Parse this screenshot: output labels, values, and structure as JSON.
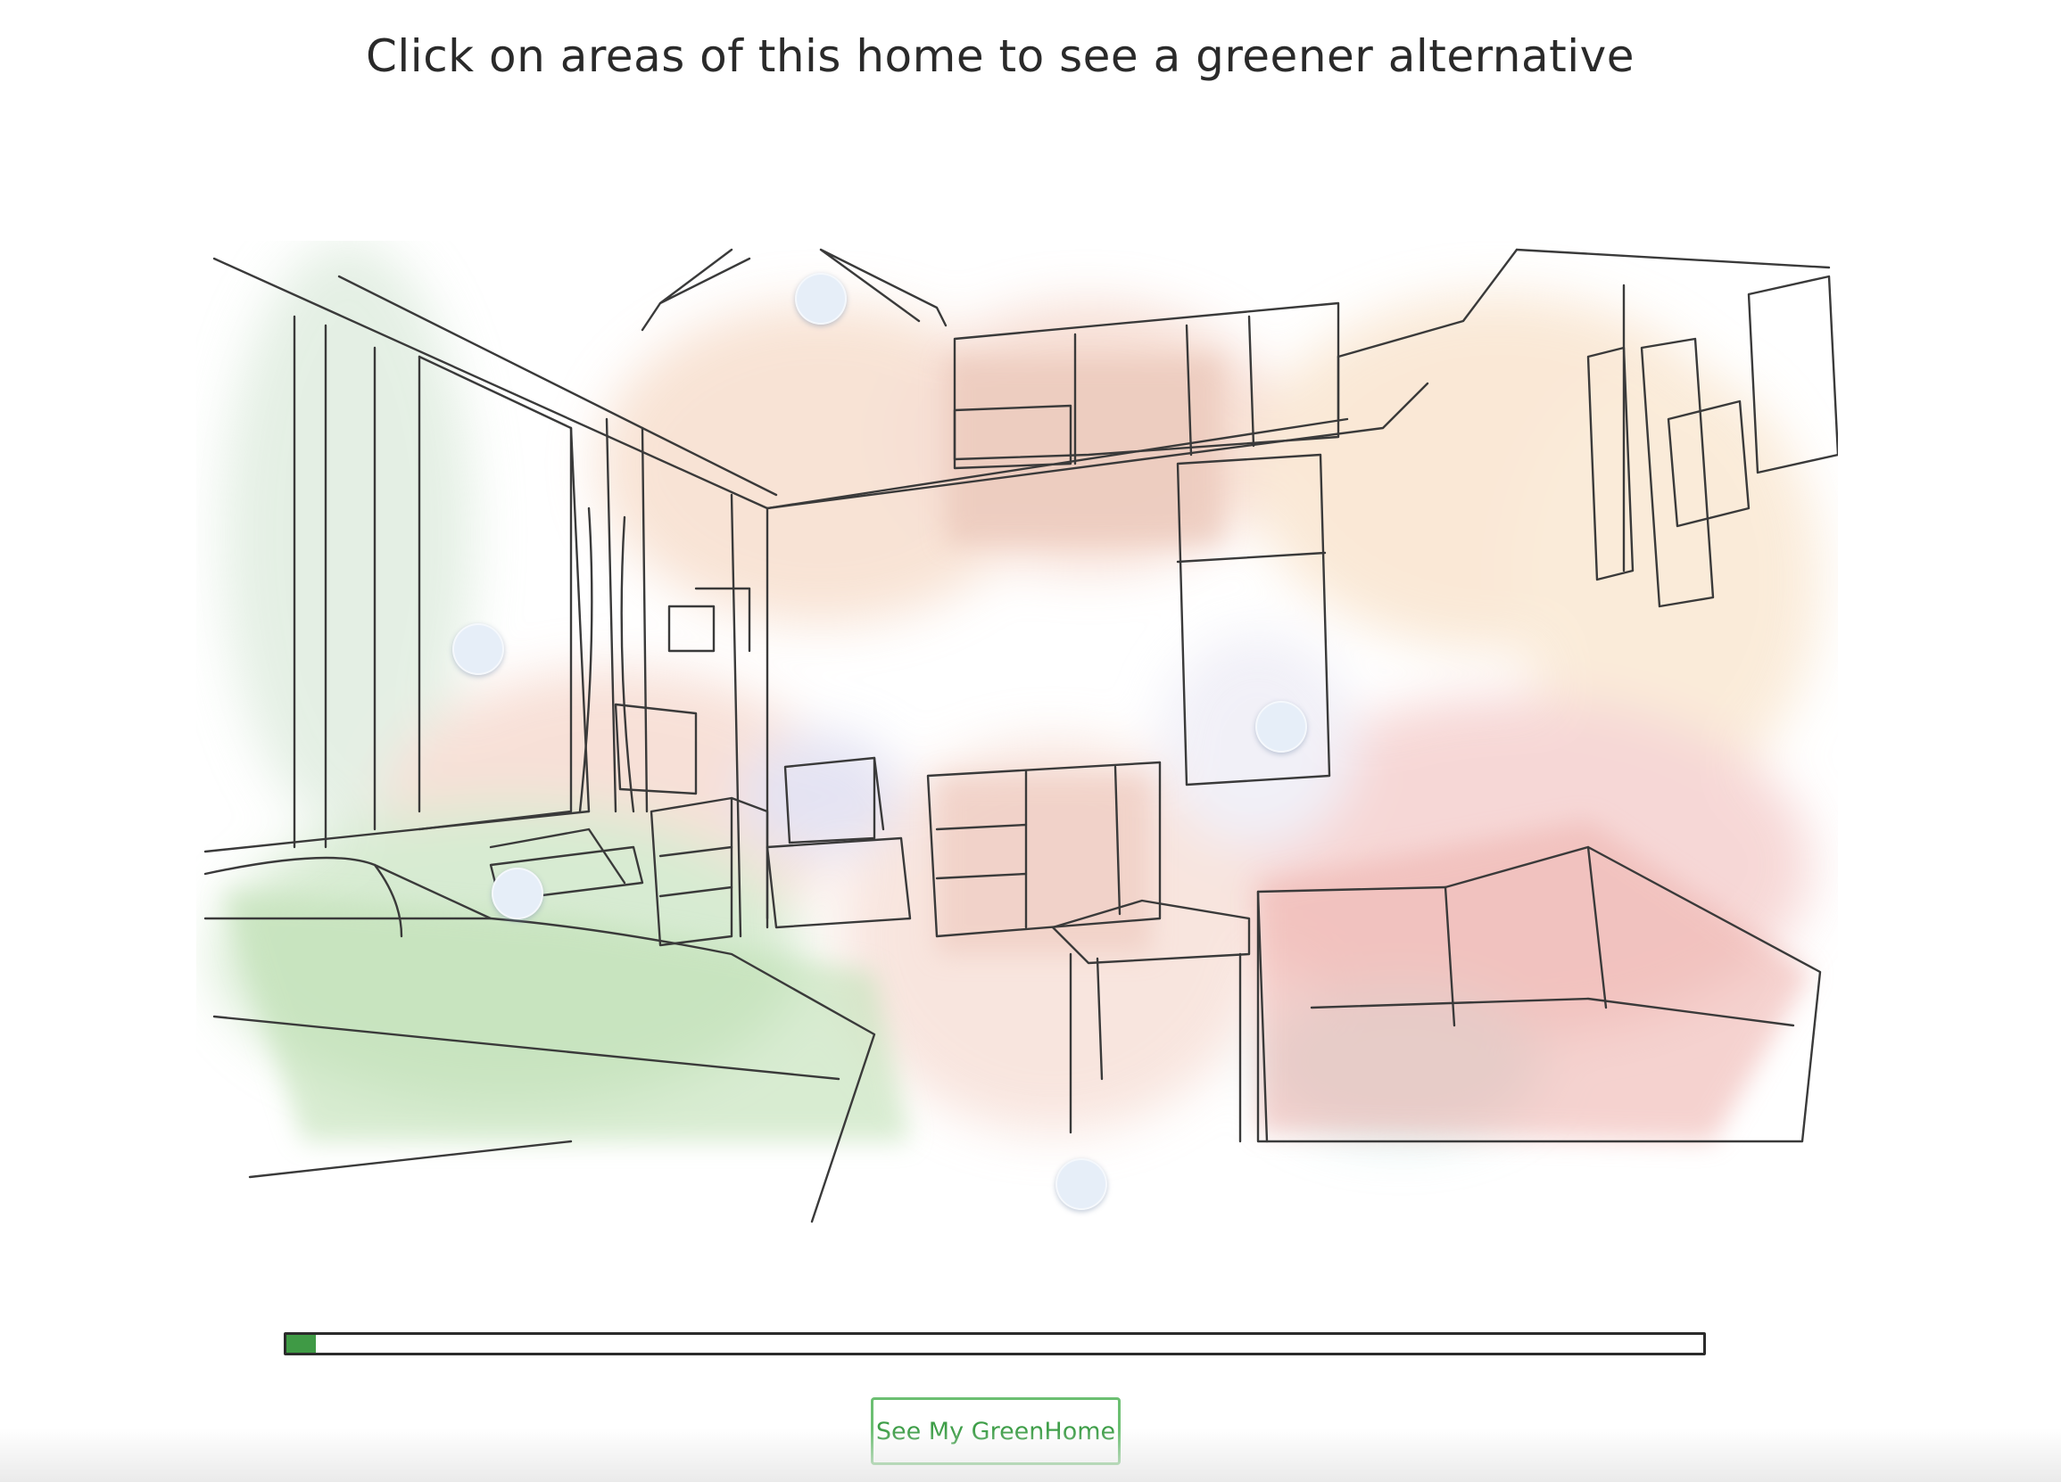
{
  "header": {
    "title": "Click on areas of this home to see a greener alternative"
  },
  "scene": {
    "hotspots": [
      {
        "name": "ceiling-light-hotspot"
      },
      {
        "name": "window-hotspot"
      },
      {
        "name": "refrigerator-hotspot"
      },
      {
        "name": "heater-hotspot"
      },
      {
        "name": "floor-hotspot"
      }
    ],
    "hotspot_color": "#e6eef8"
  },
  "progress": {
    "fraction": 0.021,
    "fill_color": "#3f9a45"
  },
  "cta": {
    "label": "See My GreenHome",
    "color": "#3e9e48"
  }
}
